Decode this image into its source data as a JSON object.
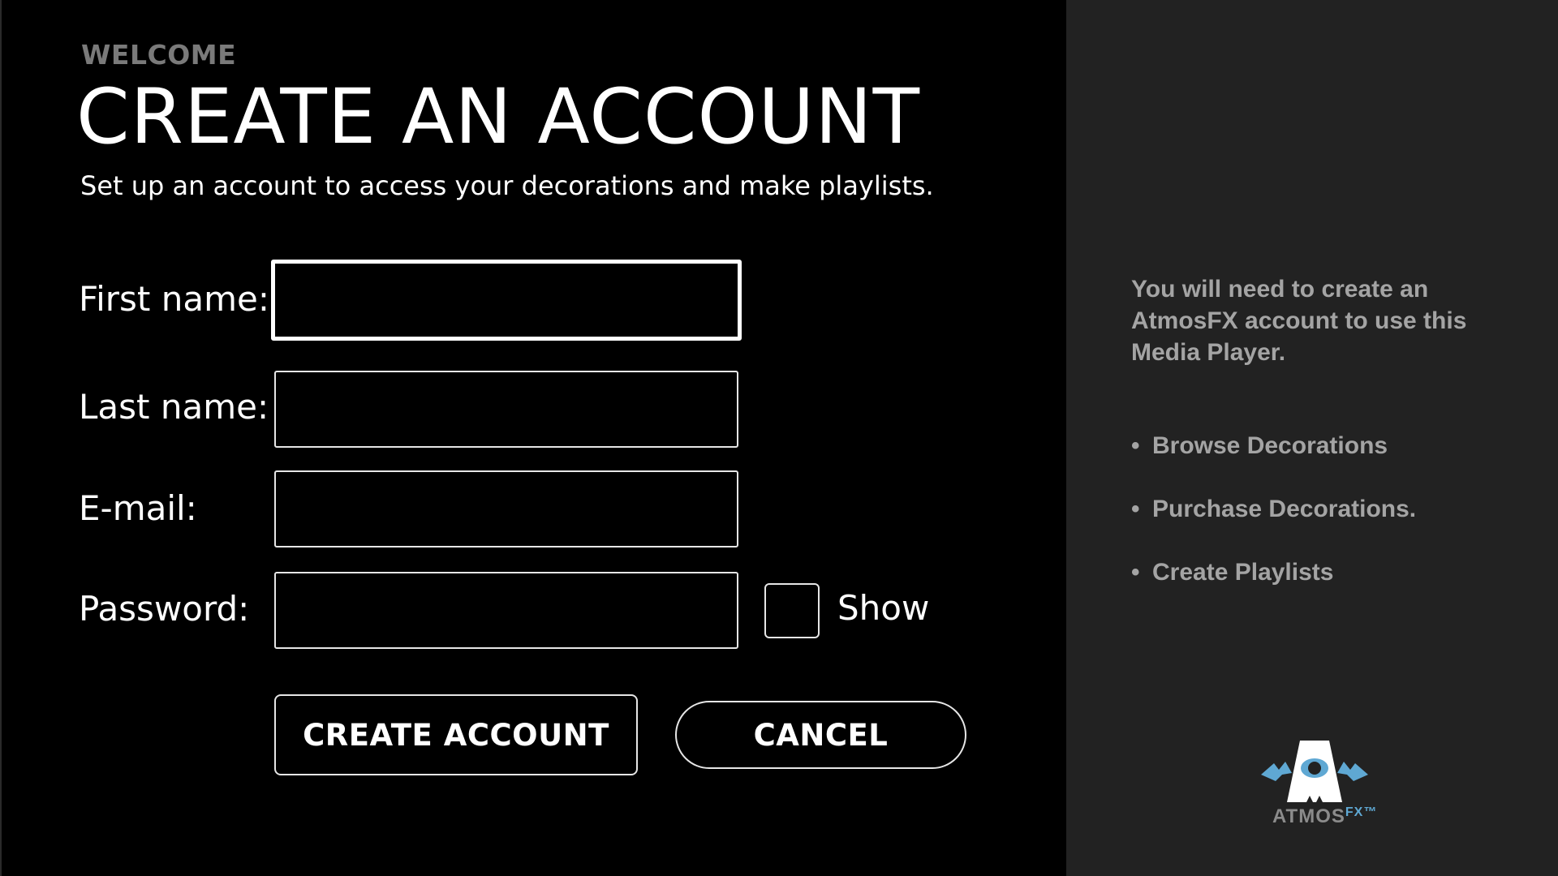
{
  "header": {
    "eyebrow": "WELCOME",
    "title": "CREATE AN ACCOUNT",
    "subtitle": "Set up an account to access your decorations and make playlists."
  },
  "form": {
    "first_name": {
      "label": "First name:",
      "value": ""
    },
    "last_name": {
      "label": "Last name:",
      "value": ""
    },
    "email": {
      "label": "E-mail:",
      "value": ""
    },
    "password": {
      "label": "Password:",
      "value": ""
    },
    "show_password": {
      "label": "Show",
      "checked": false
    }
  },
  "buttons": {
    "create_account": "CREATE ACCOUNT",
    "cancel": "CANCEL"
  },
  "sidebar": {
    "intro": "You will need to create an AtmosFX account to use this Media Player.",
    "features": [
      "Browse Decorations",
      "Purchase Decorations.",
      "Create Playlists"
    ]
  },
  "logo": {
    "name": "AtmosFX",
    "main_text": "ATMOS",
    "sub_text": "FX",
    "trademark": "™",
    "accent_color": "#5fa8d3"
  },
  "colors": {
    "background": "#000000",
    "side_panel": "#222222",
    "muted_text": "#a4a4a4"
  }
}
